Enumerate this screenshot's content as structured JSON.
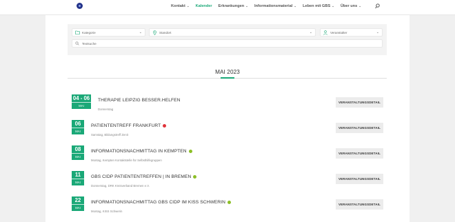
{
  "nav": {
    "items": [
      {
        "label": "Kontakt",
        "dropdown": true,
        "active": false
      },
      {
        "label": "Kalender",
        "dropdown": false,
        "active": true
      },
      {
        "label": "Erkrankungen",
        "dropdown": true,
        "active": false
      },
      {
        "label": "Informationsmaterial",
        "dropdown": true,
        "active": false
      },
      {
        "label": "Leben mit GBS",
        "dropdown": true,
        "active": false
      },
      {
        "label": "Über uns",
        "dropdown": true,
        "active": false
      }
    ],
    "search_icon": "magnifier-icon"
  },
  "filters": {
    "kategorie": "Kategorie",
    "standort": "Standort",
    "veranstalter": "Veranstalter",
    "search_placeholder": "Textsuche"
  },
  "month": {
    "title": "MAI 2023"
  },
  "events": [
    {
      "day": "04 - 06",
      "month": "MAI",
      "title": "THERAPIE LEIPZIG BESSER.HELFEN",
      "subtitle": "Donnerstag",
      "status": "",
      "button": "VERANSTALTUNGSDETAIL"
    },
    {
      "day": "06",
      "month": "MAI",
      "title": "PATIENTENTREFF FRANKFURT",
      "subtitle": "Samstag, Bildungstreff Zenit",
      "status": "red",
      "button": "VERANSTALTUNGSDETAIL"
    },
    {
      "day": "08",
      "month": "MAI",
      "title": "INFORMATIONSNACHMITTAG IN KEMPTEN",
      "subtitle": "Montag, Kempten Kontaktstelle für Selbsthilfegruppen",
      "status": "green",
      "button": "VERANSTALTUNGSDETAIL"
    },
    {
      "day": "11",
      "month": "MAI",
      "title": "GBS CIDP PATIENTENTREFFEN | IN BREMEN",
      "subtitle": "Donnerstag, DRK Kreisverband Bremen e.V.",
      "status": "green",
      "button": "VERANSTALTUNGSDETAIL"
    },
    {
      "day": "22",
      "month": "MAI",
      "title": "INFORMATIONSNACHMITTAG GBS CIDP IM KISS SCHWERIN",
      "subtitle": "Montag, KISS Schwerin",
      "status": "green",
      "button": "VERANSTALTUNGSDETAIL"
    }
  ],
  "colors": {
    "accent": "#1aa877",
    "status_red": "#e0333a",
    "status_green": "#8cbf26"
  }
}
